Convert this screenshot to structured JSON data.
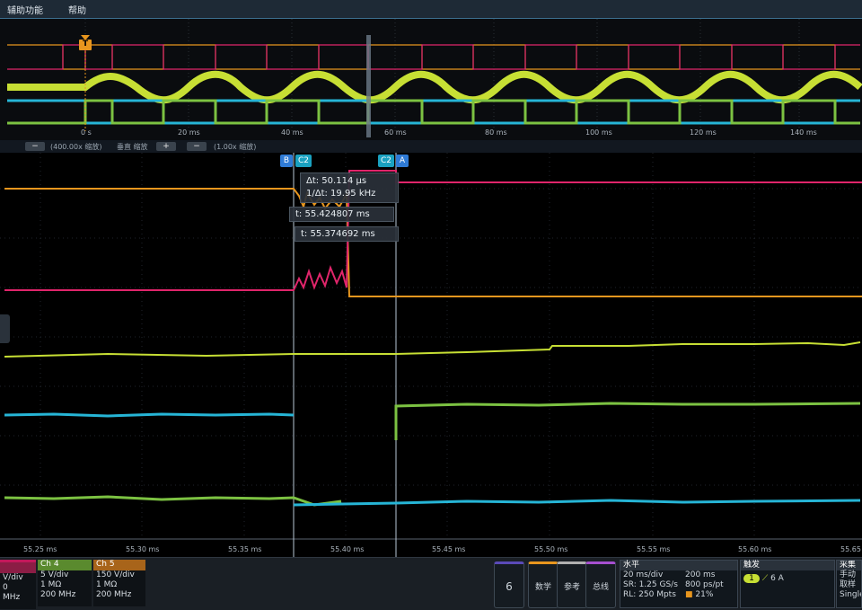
{
  "menu": {
    "item1": "辅助功能",
    "item2": "帮助"
  },
  "overview": {
    "trigger_marker": "T",
    "time_ticks": [
      "0 s",
      "20 ms",
      "40 ms",
      "60 ms",
      "80 ms",
      "100 ms",
      "120 ms",
      "140 ms"
    ]
  },
  "zoom": {
    "minus1": "−",
    "zoom_text": "(400.00x 缩放)",
    "vertical_label": "垂直 缩放",
    "plus": "+",
    "minus2": "−",
    "vzoom_text": "(1.00x 缩放)"
  },
  "cursors": {
    "b": "B",
    "c2_left": "C2",
    "c2_right": "C2",
    "a": "A"
  },
  "readouts": {
    "delta_t": "Δt: 50.114 µs",
    "inv_delta_t": "1/Δt: 19.95 kHz",
    "t1": "t: 55.424807 ms",
    "t2": "t: 55.374692 ms"
  },
  "time_axis": [
    "55.25 ms",
    "55.30 ms",
    "55.35 ms",
    "55.40 ms",
    "55.45 ms",
    "55.50 ms",
    "55.55 ms",
    "55.60 ms",
    "55.65"
  ],
  "channels": [
    {
      "head": "",
      "color": "#c2185b",
      "lines": [
        "V/div",
        "0",
        "MHz"
      ]
    },
    {
      "head": "Ch 4",
      "color": "#7cb342",
      "lines": [
        "5 V/div",
        "1 MΩ",
        "200 MHz"
      ]
    },
    {
      "head": "Ch 5",
      "color": "#e08a1e",
      "lines": [
        "150 V/div",
        "1 MΩ",
        "200 MHz"
      ]
    }
  ],
  "buttons": {
    "add_channel": "6",
    "math": "数学",
    "ref": "参考",
    "bus": "总线"
  },
  "horizontal": {
    "title": "水平",
    "scale": "20 ms/div",
    "record_time": "200 ms",
    "sample_rate": "SR: 1.25 GS/s",
    "pt_spacing": "800 ps/pt",
    "record_length": "RL: 250 Mpts",
    "pct": "21%"
  },
  "trigger": {
    "title": "触发",
    "source": "1",
    "level": "6 A"
  },
  "acquire": {
    "title": "采集",
    "mode": "手动",
    "type": "取样",
    "single": "Single"
  },
  "colors": {
    "ch1": "#c7df34",
    "ch2": "#26b5d6",
    "ch3": "#e0256b",
    "ch4": "#7cc242",
    "ch5": "#e8961e",
    "accent": "#3c6e8e"
  }
}
